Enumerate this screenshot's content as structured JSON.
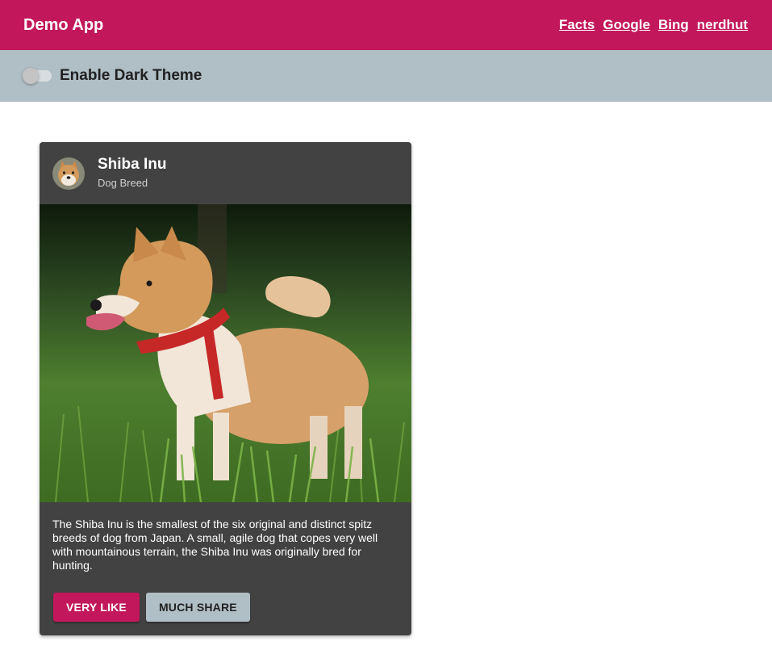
{
  "toolbar": {
    "title": "Demo App",
    "links": [
      "Facts",
      "Google",
      "Bing",
      "nerdhut"
    ]
  },
  "theme_bar": {
    "toggle_label": "Enable Dark Theme",
    "toggle_on": false
  },
  "card": {
    "title": "Shiba Inu",
    "subtitle": "Dog Breed",
    "avatar_icon": "shiba-inu-avatar",
    "image_icon": "shiba-inu-photo",
    "description": "The Shiba Inu is the smallest of the six original and distinct spitz breeds of dog from Japan. A small, agile dog that copes very well with mountainous terrain, the Shiba Inu was originally bred for hunting.",
    "actions": {
      "like_label": "VERY LIKE",
      "share_label": "MUCH SHARE"
    }
  },
  "colors": {
    "primary": "#c2185b",
    "accent": "#b0bec5",
    "card_background": "#424242"
  }
}
